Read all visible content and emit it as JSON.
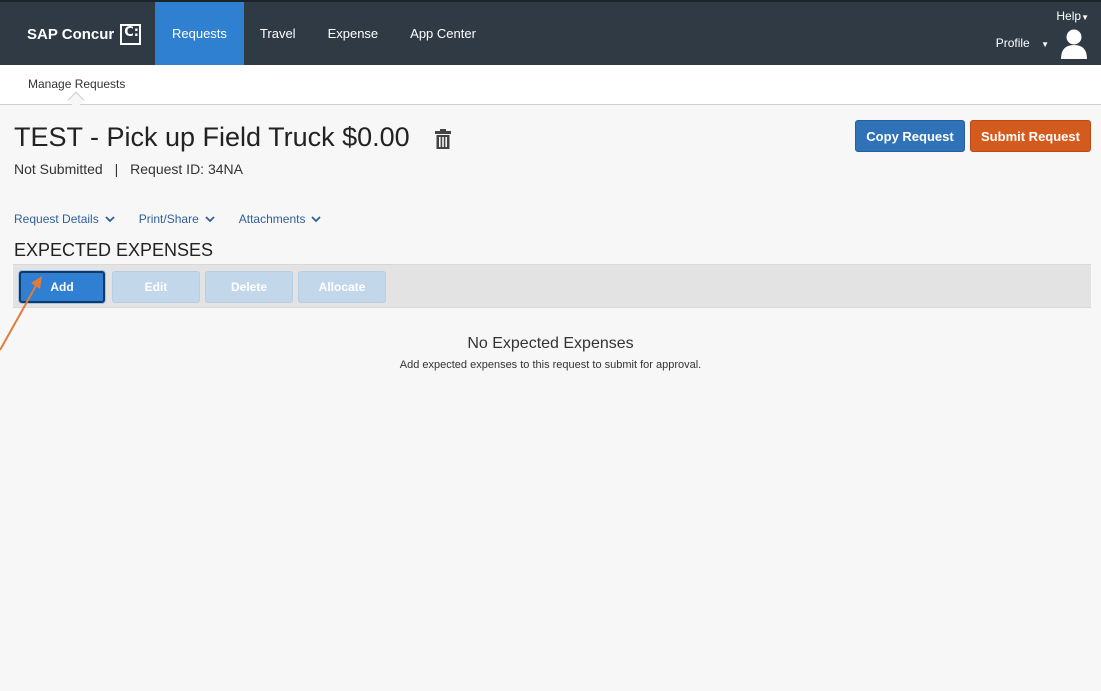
{
  "brand": {
    "name": "SAP Concur",
    "logo_glyph": "C:"
  },
  "nav": {
    "items": [
      {
        "label": "Requests"
      },
      {
        "label": "Travel"
      },
      {
        "label": "Expense"
      },
      {
        "label": "App Center"
      }
    ],
    "help_label": "Help",
    "profile_label": "Profile"
  },
  "subnav": {
    "label": "Manage Requests"
  },
  "request": {
    "title": "TEST - Pick up Field Truck $0.00",
    "status": "Not Submitted",
    "separator": "|",
    "id_text": "Request ID: 34NA"
  },
  "actions": {
    "copy_label": "Copy Request",
    "submit_label": "Submit Request"
  },
  "menus": {
    "items": [
      {
        "label": "Request Details"
      },
      {
        "label": "Print/Share"
      },
      {
        "label": "Attachments"
      }
    ]
  },
  "expected_expenses": {
    "heading": "EXPECTED EXPENSES",
    "toolbar": {
      "add_label": "Add",
      "edit_label": "Edit",
      "delete_label": "Delete",
      "allocate_label": "Allocate"
    },
    "empty_title": "No Expected Expenses",
    "empty_subtitle": "Add expected expenses to this request to submit for approval."
  },
  "colors": {
    "topbar": "#2f3a45",
    "nav_active": "#2f80d1",
    "copy_button": "#2f72b8",
    "submit_button": "#d45a1e",
    "annotation_arrow": "#e07b39"
  },
  "icons": {
    "trash": "trash-icon",
    "user": "user-avatar-icon",
    "chevron": "chevron-down-icon"
  }
}
